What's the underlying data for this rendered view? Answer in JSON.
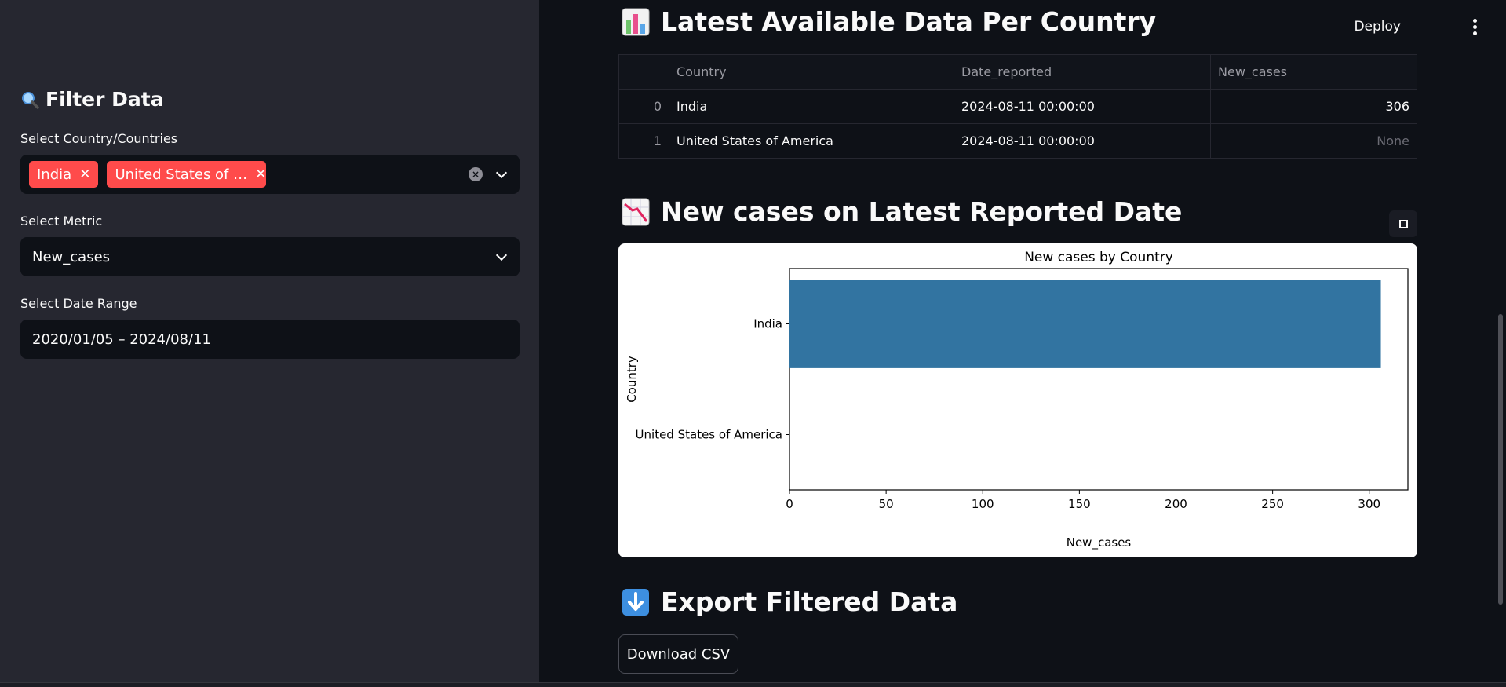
{
  "sidebar": {
    "title": "Filter Data",
    "title_icon": "magnifier-icon",
    "country_label": "Select Country/Countries",
    "selected_countries": [
      "India",
      "United States of …"
    ],
    "metric_label": "Select Metric",
    "metric_value": "New_cases",
    "date_label": "Select Date Range",
    "date_value": "2020/01/05 – 2024/08/11"
  },
  "header": {
    "deploy_label": "Deploy",
    "menu_icon": "kebab-menu-icon"
  },
  "sections": {
    "latest_title": "Latest Available Data Per Country",
    "chart_title": "New cases on Latest Reported Date",
    "export_title": "Export Filtered Data"
  },
  "table": {
    "columns": [
      "",
      "Country",
      "Date_reported",
      "New_cases"
    ],
    "rows": [
      [
        "0",
        "India",
        "2024-08-11 00:00:00",
        "306"
      ],
      [
        "1",
        "United States of America",
        "2024-08-11 00:00:00",
        "None"
      ]
    ]
  },
  "export": {
    "button_label": "Download CSV"
  },
  "colors": {
    "accent": "#ff4b4b",
    "bar": "#3274a1",
    "bg": "#0e1117",
    "sidebar_bg": "#262730"
  },
  "chart_data": {
    "type": "bar",
    "orientation": "horizontal",
    "title": "New cases by Country",
    "xlabel": "New_cases",
    "ylabel": "Country",
    "categories": [
      "India",
      "United States of America"
    ],
    "values": [
      306,
      null
    ],
    "xlim": [
      0,
      320
    ],
    "xticks": [
      0,
      50,
      100,
      150,
      200,
      250,
      300
    ],
    "grid": false
  }
}
